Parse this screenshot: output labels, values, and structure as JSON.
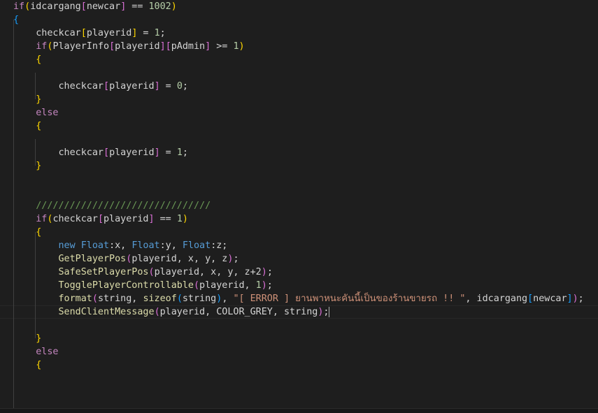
{
  "editor": {
    "colors": {
      "background": "#1e1e1e",
      "default": "#d4d4d4",
      "keyword_control": "#c586c0",
      "keyword": "#569cd6",
      "function": "#dcdcaa",
      "type": "#4ec9b0",
      "variable": "#9cdcfe",
      "number": "#b5cea8",
      "string": "#ce9178",
      "comment": "#6a9955",
      "bracket_gold": "#ffd700",
      "bracket_purple": "#da70d6",
      "bracket_blue": "#179fff"
    },
    "lines": [
      {
        "tokens": [
          {
            "t": "if",
            "c": "keyword_control"
          },
          {
            "t": "(",
            "c": "bracket_gold"
          },
          {
            "t": "idcargang",
            "c": "default"
          },
          {
            "t": "[",
            "c": "bracket_purple"
          },
          {
            "t": "newcar",
            "c": "default"
          },
          {
            "t": "]",
            "c": "bracket_purple"
          },
          {
            "t": " == ",
            "c": "default"
          },
          {
            "t": "1002",
            "c": "number"
          },
          {
            "t": ")",
            "c": "bracket_gold"
          }
        ]
      },
      {
        "tokens": [
          {
            "t": "{",
            "c": "bracket_blue"
          }
        ]
      },
      {
        "tokens": [
          {
            "t": "    checkcar",
            "c": "default"
          },
          {
            "t": "[",
            "c": "bracket_gold"
          },
          {
            "t": "playerid",
            "c": "default"
          },
          {
            "t": "]",
            "c": "bracket_gold"
          },
          {
            "t": " = ",
            "c": "default"
          },
          {
            "t": "1",
            "c": "number"
          },
          {
            "t": ";",
            "c": "default"
          }
        ]
      },
      {
        "tokens": [
          {
            "t": "    ",
            "c": "default"
          },
          {
            "t": "if",
            "c": "keyword_control"
          },
          {
            "t": "(",
            "c": "bracket_gold"
          },
          {
            "t": "PlayerInfo",
            "c": "default"
          },
          {
            "t": "[",
            "c": "bracket_purple"
          },
          {
            "t": "playerid",
            "c": "default"
          },
          {
            "t": "]",
            "c": "bracket_purple"
          },
          {
            "t": "[",
            "c": "bracket_purple"
          },
          {
            "t": "pAdmin",
            "c": "default"
          },
          {
            "t": "]",
            "c": "bracket_purple"
          },
          {
            "t": " >= ",
            "c": "default"
          },
          {
            "t": "1",
            "c": "number"
          },
          {
            "t": ")",
            "c": "bracket_gold"
          }
        ]
      },
      {
        "tokens": [
          {
            "t": "    ",
            "c": "default"
          },
          {
            "t": "{",
            "c": "bracket_gold"
          }
        ]
      },
      {
        "tokens": [
          {
            "t": "",
            "c": "default"
          }
        ]
      },
      {
        "tokens": [
          {
            "t": "        checkcar",
            "c": "default"
          },
          {
            "t": "[",
            "c": "bracket_purple"
          },
          {
            "t": "playerid",
            "c": "default"
          },
          {
            "t": "]",
            "c": "bracket_purple"
          },
          {
            "t": " = ",
            "c": "default"
          },
          {
            "t": "0",
            "c": "number"
          },
          {
            "t": ";",
            "c": "default"
          }
        ]
      },
      {
        "tokens": [
          {
            "t": "    ",
            "c": "default"
          },
          {
            "t": "}",
            "c": "bracket_gold"
          }
        ]
      },
      {
        "tokens": [
          {
            "t": "    ",
            "c": "default"
          },
          {
            "t": "else",
            "c": "keyword_control"
          }
        ]
      },
      {
        "tokens": [
          {
            "t": "    ",
            "c": "default"
          },
          {
            "t": "{",
            "c": "bracket_gold"
          }
        ]
      },
      {
        "tokens": [
          {
            "t": "",
            "c": "default"
          }
        ]
      },
      {
        "tokens": [
          {
            "t": "        checkcar",
            "c": "default"
          },
          {
            "t": "[",
            "c": "bracket_purple"
          },
          {
            "t": "playerid",
            "c": "default"
          },
          {
            "t": "]",
            "c": "bracket_purple"
          },
          {
            "t": " = ",
            "c": "default"
          },
          {
            "t": "1",
            "c": "number"
          },
          {
            "t": ";",
            "c": "default"
          }
        ]
      },
      {
        "tokens": [
          {
            "t": "    ",
            "c": "default"
          },
          {
            "t": "}",
            "c": "bracket_gold"
          }
        ]
      },
      {
        "tokens": [
          {
            "t": "",
            "c": "default"
          }
        ]
      },
      {
        "tokens": [
          {
            "t": "",
            "c": "default"
          }
        ]
      },
      {
        "tokens": [
          {
            "t": "    ",
            "c": "default"
          },
          {
            "t": "///////////////////////////////",
            "c": "comment"
          }
        ]
      },
      {
        "tokens": [
          {
            "t": "    ",
            "c": "default"
          },
          {
            "t": "if",
            "c": "keyword_control"
          },
          {
            "t": "(",
            "c": "bracket_gold"
          },
          {
            "t": "checkcar",
            "c": "default"
          },
          {
            "t": "[",
            "c": "bracket_purple"
          },
          {
            "t": "playerid",
            "c": "default"
          },
          {
            "t": "]",
            "c": "bracket_purple"
          },
          {
            "t": " == ",
            "c": "default"
          },
          {
            "t": "1",
            "c": "number"
          },
          {
            "t": ")",
            "c": "bracket_gold"
          }
        ]
      },
      {
        "tokens": [
          {
            "t": "    ",
            "c": "default"
          },
          {
            "t": "{",
            "c": "bracket_gold"
          }
        ]
      },
      {
        "tokens": [
          {
            "t": "        ",
            "c": "default"
          },
          {
            "t": "new",
            "c": "keyword"
          },
          {
            "t": " ",
            "c": "default"
          },
          {
            "t": "Float",
            "c": "keyword"
          },
          {
            "t": ":x, ",
            "c": "default"
          },
          {
            "t": "Float",
            "c": "keyword"
          },
          {
            "t": ":y, ",
            "c": "default"
          },
          {
            "t": "Float",
            "c": "keyword"
          },
          {
            "t": ":z;",
            "c": "default"
          }
        ]
      },
      {
        "tokens": [
          {
            "t": "        ",
            "c": "default"
          },
          {
            "t": "GetPlayerPos",
            "c": "function"
          },
          {
            "t": "(",
            "c": "bracket_purple"
          },
          {
            "t": "playerid, x, y, z",
            "c": "default"
          },
          {
            "t": ")",
            "c": "bracket_purple"
          },
          {
            "t": ";",
            "c": "default"
          }
        ]
      },
      {
        "tokens": [
          {
            "t": "        ",
            "c": "default"
          },
          {
            "t": "SafeSetPlayerPos",
            "c": "function"
          },
          {
            "t": "(",
            "c": "bracket_purple"
          },
          {
            "t": "playerid, x, y, z+2",
            "c": "default"
          },
          {
            "t": ")",
            "c": "bracket_purple"
          },
          {
            "t": ";",
            "c": "default"
          }
        ]
      },
      {
        "tokens": [
          {
            "t": "        ",
            "c": "default"
          },
          {
            "t": "TogglePlayerControllable",
            "c": "function"
          },
          {
            "t": "(",
            "c": "bracket_purple"
          },
          {
            "t": "playerid, ",
            "c": "default"
          },
          {
            "t": "1",
            "c": "number"
          },
          {
            "t": ")",
            "c": "bracket_purple"
          },
          {
            "t": ";",
            "c": "default"
          }
        ]
      },
      {
        "tokens": [
          {
            "t": "        ",
            "c": "default"
          },
          {
            "t": "format",
            "c": "function"
          },
          {
            "t": "(",
            "c": "bracket_purple"
          },
          {
            "t": "string, ",
            "c": "default"
          },
          {
            "t": "sizeof",
            "c": "function"
          },
          {
            "t": "(",
            "c": "bracket_blue"
          },
          {
            "t": "string",
            "c": "default"
          },
          {
            "t": ")",
            "c": "bracket_blue"
          },
          {
            "t": ", ",
            "c": "default"
          },
          {
            "t": "\"[ ERROR ] ยานพาหนะคันนี้เป็นของร้านขายรถ !! \"",
            "c": "string"
          },
          {
            "t": ", idcargang",
            "c": "default"
          },
          {
            "t": "[",
            "c": "bracket_blue"
          },
          {
            "t": "newcar",
            "c": "default"
          },
          {
            "t": "]",
            "c": "bracket_blue"
          },
          {
            "t": ")",
            "c": "bracket_purple"
          },
          {
            "t": ";",
            "c": "default"
          }
        ]
      },
      {
        "tokens": [
          {
            "t": "        ",
            "c": "default"
          },
          {
            "t": "SendClientMessage",
            "c": "function"
          },
          {
            "t": "(",
            "c": "bracket_purple"
          },
          {
            "t": "playerid, COLOR_GREY, string",
            "c": "default"
          },
          {
            "t": ")",
            "c": "bracket_purple"
          },
          {
            "t": ";",
            "c": "default"
          }
        ],
        "caret": true
      },
      {
        "tokens": [
          {
            "t": "",
            "c": "default"
          }
        ]
      },
      {
        "tokens": [
          {
            "t": "    ",
            "c": "default"
          },
          {
            "t": "}",
            "c": "bracket_gold"
          }
        ]
      },
      {
        "tokens": [
          {
            "t": "    ",
            "c": "default"
          },
          {
            "t": "else",
            "c": "keyword_control"
          }
        ]
      },
      {
        "tokens": [
          {
            "t": "    ",
            "c": "default"
          },
          {
            "t": "{",
            "c": "bracket_gold"
          }
        ]
      }
    ]
  }
}
